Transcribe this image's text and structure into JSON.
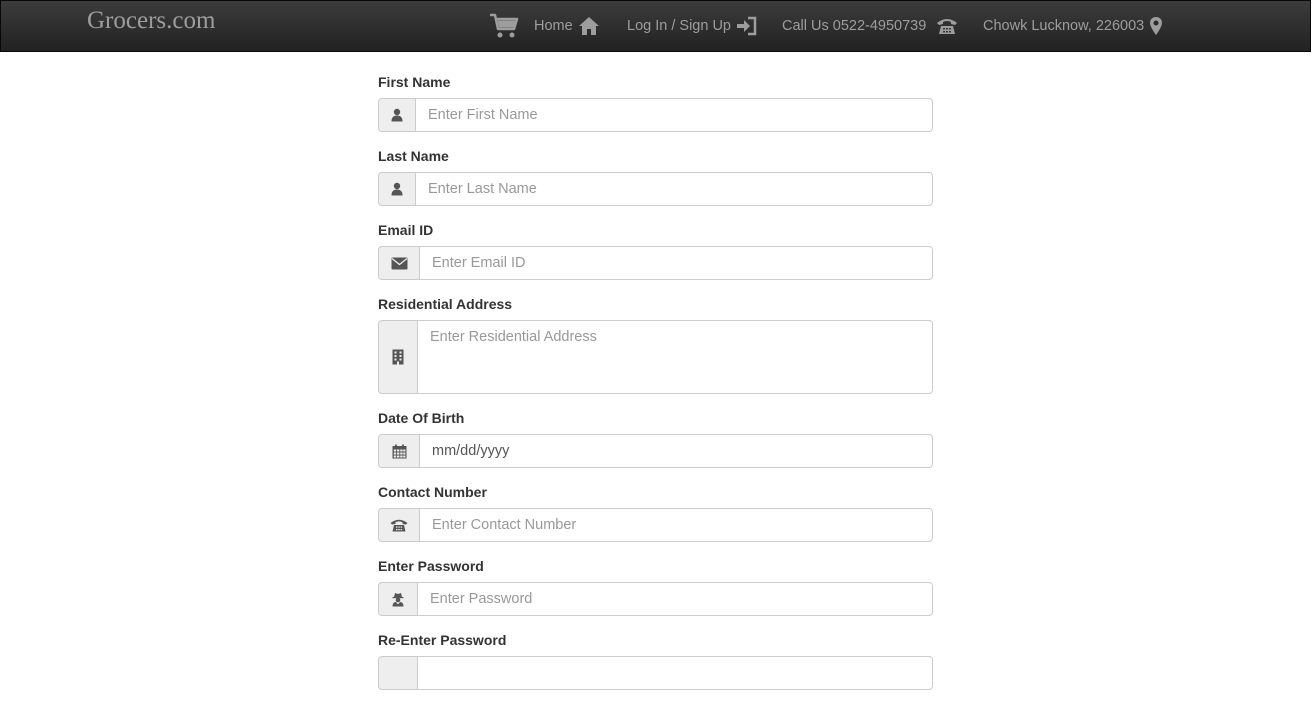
{
  "navbar": {
    "brand": "Grocers.com",
    "home_label": "Home",
    "login_label": "Log In / Sign Up",
    "call_label": "Call Us 0522-4950739",
    "location_label": "Chowk Lucknow, 226003",
    "icons": {
      "cart": "shopping-cart-icon",
      "home": "home-icon",
      "login": "log-in-icon",
      "phone": "phone-icon",
      "location": "map-marker-icon"
    }
  },
  "form": {
    "first_name": {
      "label": "First Name",
      "placeholder": "Enter First Name",
      "icon": "user-icon"
    },
    "last_name": {
      "label": "Last Name",
      "placeholder": "Enter Last Name",
      "icon": "user-icon"
    },
    "email": {
      "label": "Email ID",
      "placeholder": "Enter Email ID",
      "icon": "envelope-icon"
    },
    "address": {
      "label": "Residential Address",
      "placeholder": "Enter Residential Address",
      "icon": "building-icon"
    },
    "dob": {
      "label": "Date Of Birth",
      "value": "mm/dd/yyyy",
      "icon": "calendar-icon"
    },
    "contact": {
      "label": "Contact Number",
      "placeholder": "Enter Contact Number",
      "icon": "phone-icon"
    },
    "password": {
      "label": "Enter Password",
      "placeholder": "Enter Password",
      "icon": "user-secret-icon"
    },
    "reenter_password": {
      "label": "Re-Enter Password"
    }
  },
  "colors": {
    "navbar_bg": "#222222",
    "nav_text": "#9d9d9d",
    "addon_bg": "#eeeeee",
    "border": "#cccccc",
    "label": "#333333"
  }
}
